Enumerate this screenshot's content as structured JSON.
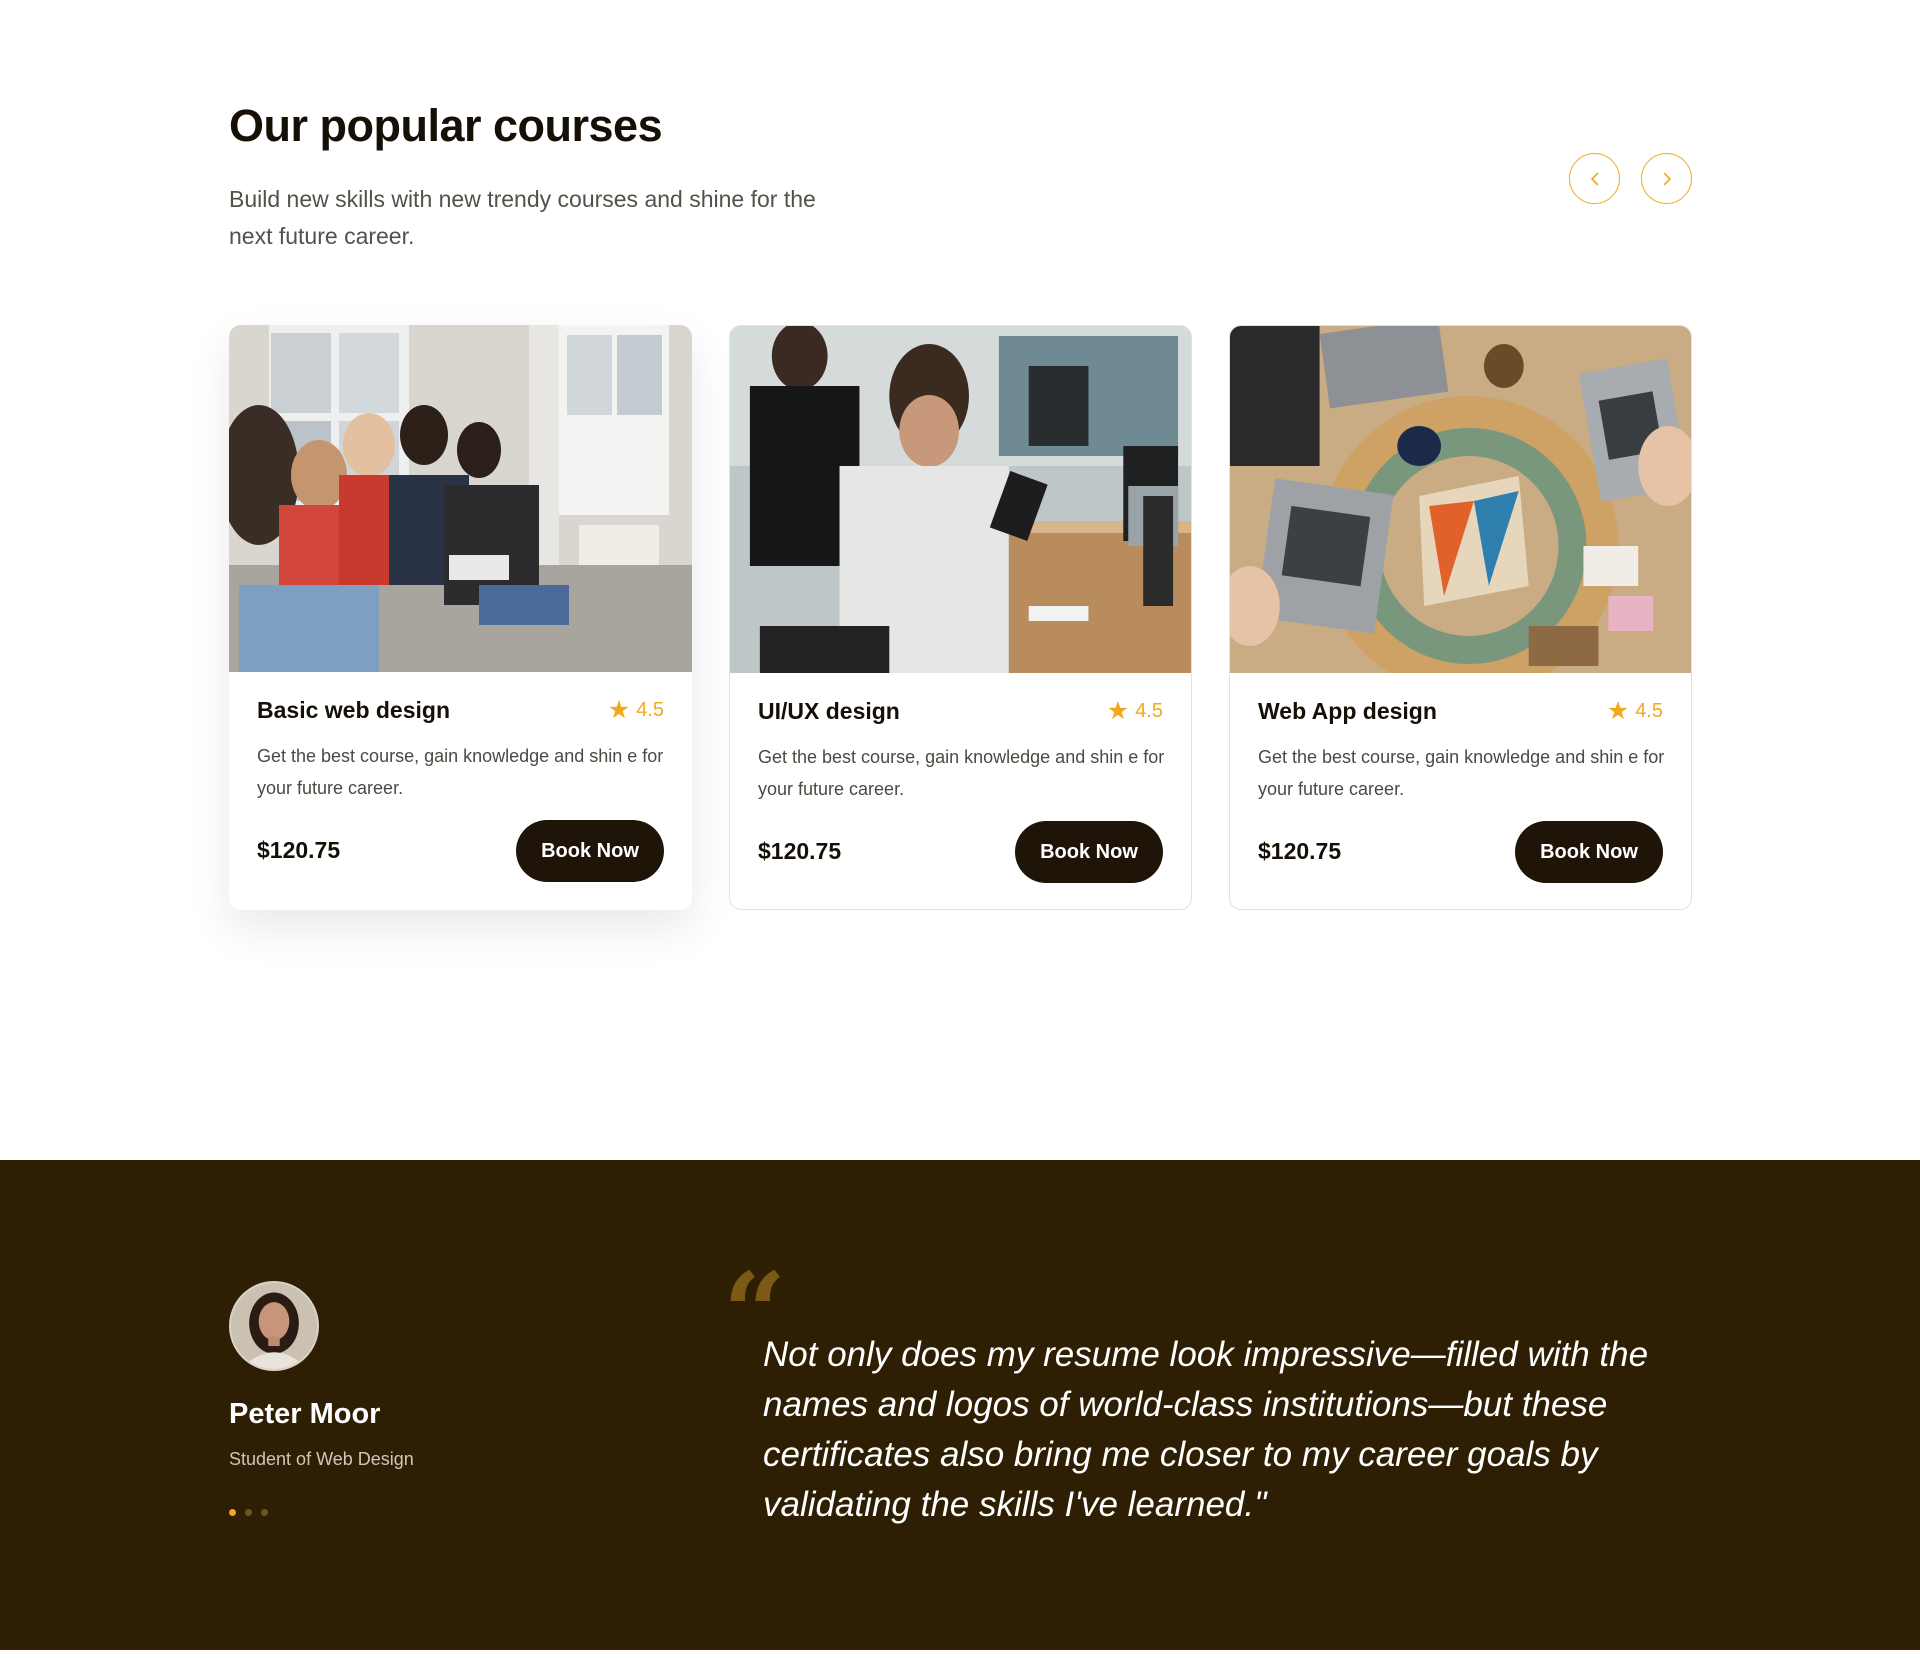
{
  "courses_section": {
    "title": "Our popular courses",
    "subtitle": "Build new skills with new trendy courses and shine for the next future career.",
    "nav": {
      "prev_icon": "chevron-left-icon",
      "next_icon": "chevron-right-icon"
    },
    "accent_color": "#f2a81d",
    "cards": [
      {
        "image": "classroom-students-photo",
        "title": "Basic web design",
        "rating": "4.5",
        "description": "Get the best course, gain knowledge and shin e for your future career.",
        "price": "$120.75",
        "button": "Book Now"
      },
      {
        "image": "developer-with-tablet-photo",
        "title": "UI/UX design",
        "rating": "4.5",
        "description": "Get the best course, gain knowledge and shin e for your future career.",
        "price": "$120.75",
        "button": "Book Now"
      },
      {
        "image": "team-laptops-table-photo",
        "title": "Web App design",
        "rating": "4.5",
        "description": "Get the best course, gain knowledge and shin e for your future career.",
        "price": "$120.75",
        "button": "Book Now"
      }
    ]
  },
  "testimonial": {
    "background_color": "#2e1f04",
    "avatar": "student-portrait-photo",
    "name": "Peter Moor",
    "role": "Student of Web Design",
    "quote_mark": "“",
    "quote": "Not only does my resume look impressive—filled with the names and logos of world-class institutions—but these certificates also bring me closer to my career goals by validating the skills I've learned.\"",
    "slides": {
      "count": 3,
      "active": 1
    }
  }
}
